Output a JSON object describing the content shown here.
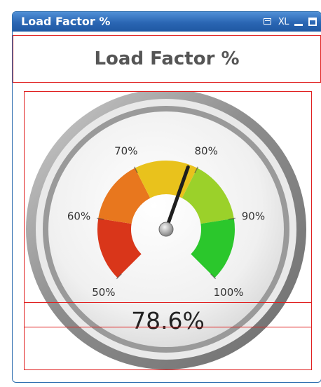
{
  "window": {
    "title": "Load Factor %",
    "xl_label": "XL",
    "icons": [
      "print-icon",
      "xl-export-icon",
      "minimize-icon",
      "maximize-icon"
    ],
    "titlebar_color": "#2a66b3"
  },
  "chart_title": "Load Factor %",
  "gauge": {
    "min": 50,
    "max": 100,
    "value": 78.6,
    "value_label": "78.6%",
    "ticks": [
      "50%",
      "60%",
      "70%",
      "80%",
      "90%",
      "100%"
    ],
    "band_colors": [
      "#d9361a",
      "#e8771e",
      "#e9c21c",
      "#9bd12a",
      "#2bc72c"
    ]
  }
}
